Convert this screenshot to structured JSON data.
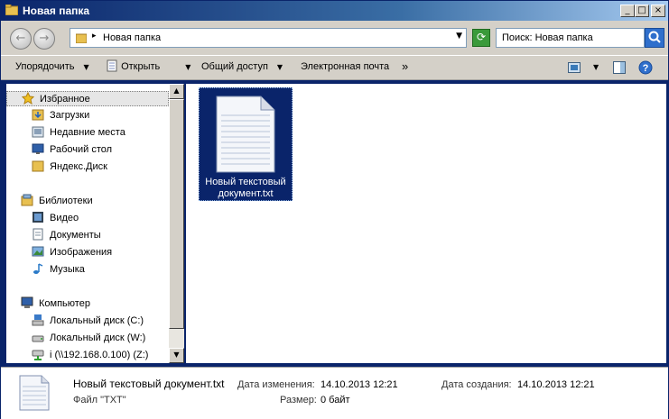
{
  "window": {
    "title": "Новая папка"
  },
  "address": {
    "path": "Новая папка"
  },
  "search": {
    "placeholder": "Поиск: Новая папка"
  },
  "toolbar": {
    "organize": "Упорядочить",
    "open": "Открыть",
    "share": "Общий доступ",
    "email": "Электронная почта",
    "more": "»"
  },
  "sidebar": {
    "favorites": "Избранное",
    "downloads": "Загрузки",
    "recent": "Недавние места",
    "desktop": "Рабочий стол",
    "yandex": "Яндекс.Диск",
    "libraries": "Библиотеки",
    "video": "Видео",
    "documents": "Документы",
    "images": "Изображения",
    "music": "Музыка",
    "computer": "Компьютер",
    "disk_c": "Локальный диск (C:)",
    "disk_w": "Локальный диск (W:)",
    "disk_z": "i (\\\\192.168.0.100) (Z:)"
  },
  "file": {
    "name_line1": "Новый текстовый",
    "name_line2": "документ.txt"
  },
  "status": {
    "filename": "Новый текстовый документ.txt",
    "modified_label": "Дата изменения:",
    "modified_value": "14.10.2013 12:21",
    "created_label": "Дата создания:",
    "created_value": "14.10.2013 12:21",
    "type": "Файл \"TXT\"",
    "size_label": "Размер:",
    "size_value": "0 байт"
  }
}
